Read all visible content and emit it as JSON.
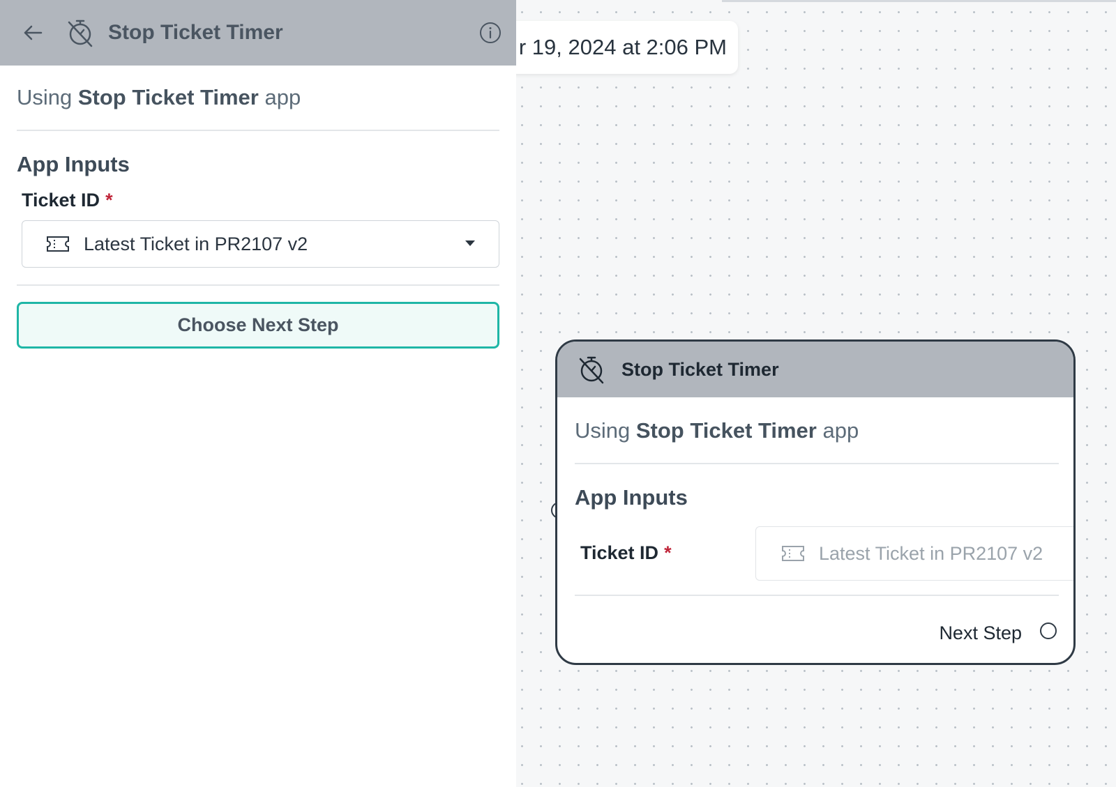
{
  "panel": {
    "title": "Stop Ticket Timer",
    "icons": {
      "back": "arrow-left-icon",
      "app": "timer-off-icon",
      "info": "info-icon"
    },
    "using_prefix": "Using ",
    "using_app": "Stop Ticket Timer",
    "using_suffix": " app",
    "section_title": "App Inputs",
    "ticket_label": "Ticket ID",
    "required_mark": "*",
    "ticket_value": "Latest Ticket in PR2107 v2",
    "choose_next_label": "Choose Next Step"
  },
  "canvas": {
    "date_chip": "r 19, 2024 at 2:06 PM",
    "node": {
      "title": "Stop Ticket Timer",
      "using_prefix": "Using ",
      "using_app": "Stop Ticket Timer",
      "using_suffix": " app",
      "section_title": "App Inputs",
      "ticket_label": "Ticket ID",
      "required_mark": "*",
      "ticket_value": "Latest Ticket in PR2107 v2",
      "next_step_label": "Next Step"
    }
  },
  "colors": {
    "header_bg": "#b1b6bd",
    "accent": "#1fb6a6",
    "required": "#c0263a"
  }
}
